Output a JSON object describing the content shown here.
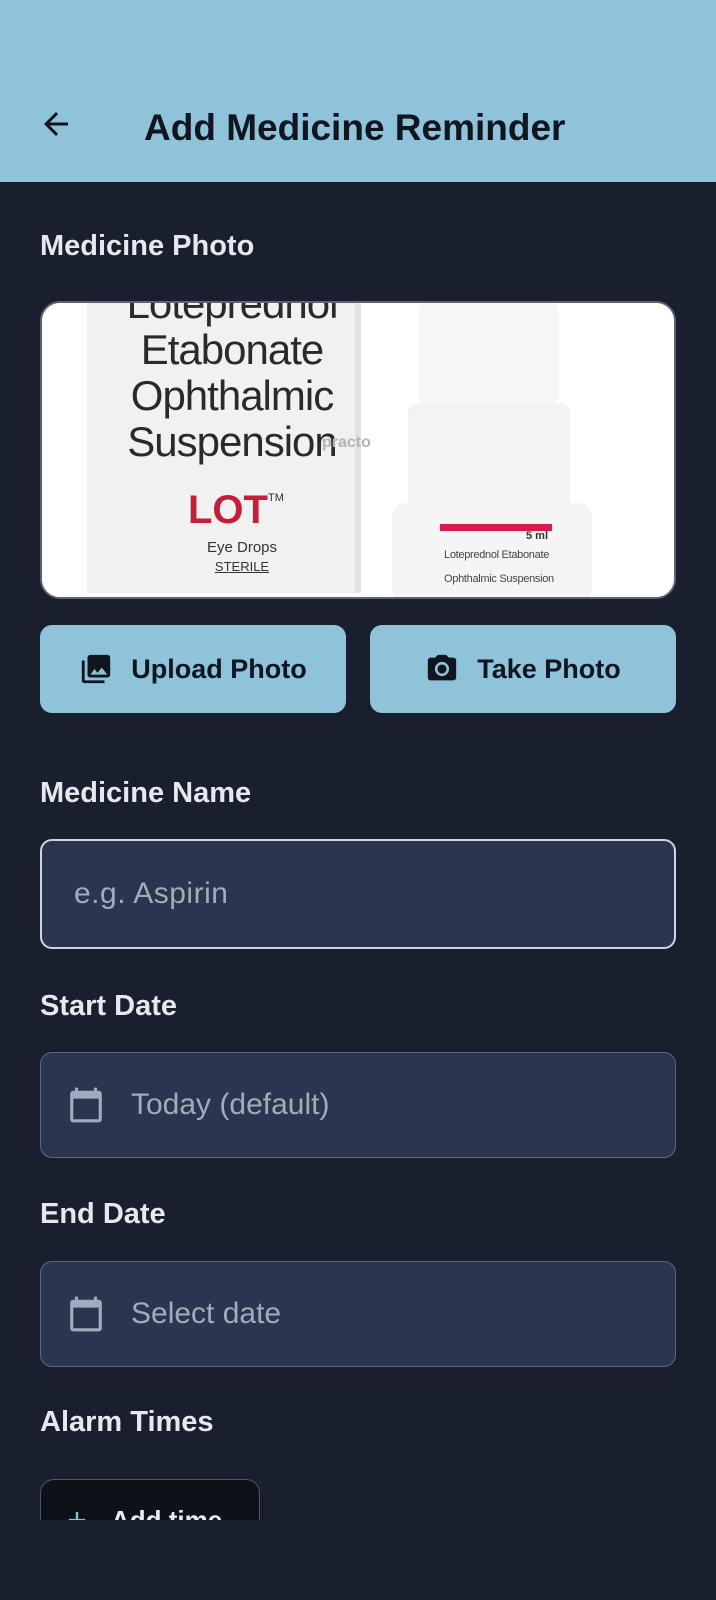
{
  "appbar": {
    "title": "Add Medicine Reminder",
    "back_icon": "arrow-left-icon"
  },
  "photo_section": {
    "label": "Medicine Photo",
    "photo": {
      "box_text": [
        "Loteprednol",
        "Etabonate",
        "Ophthalmic",
        "Suspension"
      ],
      "brand": "LOT",
      "trademark": "TM",
      "subtitle": "Eye Drops",
      "sterile": "STERILE",
      "watermark": "practo",
      "bottle_volume": "5 ml",
      "bottle_label": [
        "Loteprednol Etabonate",
        "Ophthalmic Suspension"
      ]
    },
    "upload_button": {
      "label": "Upload Photo",
      "icon": "gallery-icon"
    },
    "take_button": {
      "label": "Take Photo",
      "icon": "camera-icon"
    }
  },
  "medicine_name": {
    "label": "Medicine Name",
    "placeholder": "e.g. Aspirin",
    "value": ""
  },
  "start_date": {
    "label": "Start Date",
    "placeholder": "Today (default)",
    "icon": "calendar-icon"
  },
  "end_date": {
    "label": "End Date",
    "placeholder": "Select date",
    "icon": "calendar-icon"
  },
  "alarm_times": {
    "label": "Alarm Times",
    "add_button": {
      "label": "Add time",
      "icon": "plus-icon"
    }
  },
  "colors": {
    "appbar": "#8ec3d9",
    "background": "#1a1f2e",
    "field": "#2a3550",
    "brand_red": "#c41e3a"
  }
}
